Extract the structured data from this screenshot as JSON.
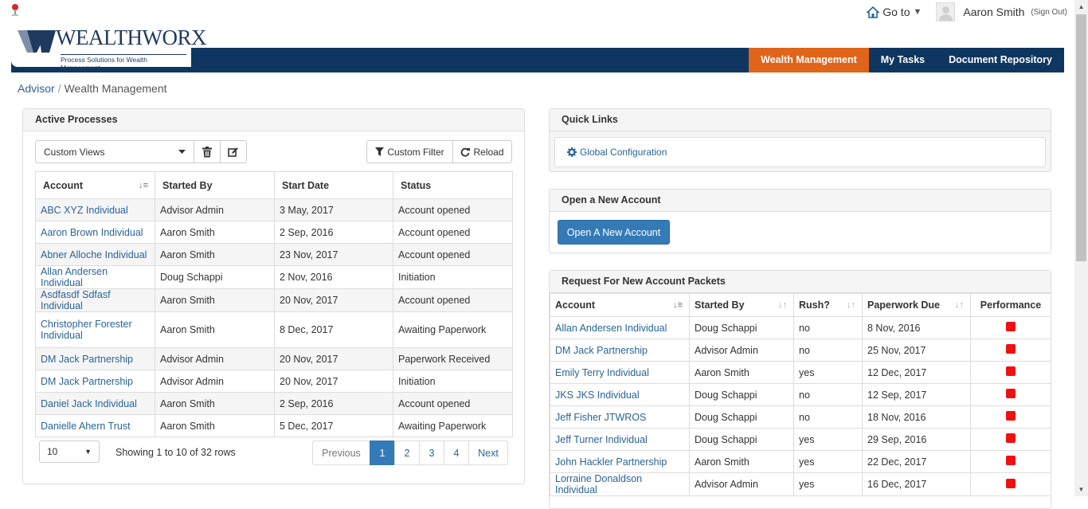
{
  "header": {
    "brand": "WEALTHWORX",
    "tagline": "Process Solutions for Wealth Management",
    "goto_label": "Go to",
    "user_name": "Aaron Smith",
    "signout_label": "(Sign Out)"
  },
  "nav": {
    "items": [
      {
        "label": "Wealth Management",
        "active": true
      },
      {
        "label": "My Tasks",
        "active": false
      },
      {
        "label": "Document Repository",
        "active": false
      }
    ]
  },
  "breadcrumb": {
    "parent": "Advisor",
    "current": "Wealth Management"
  },
  "active_processes": {
    "title": "Active Processes",
    "views_select": "Custom Views",
    "custom_filter_label": "Custom Filter",
    "reload_label": "Reload",
    "columns": [
      "Account",
      "Started By",
      "Start Date",
      "Status"
    ],
    "rows": [
      [
        "ABC XYZ Individual",
        "Advisor Admin",
        "3 May, 2017",
        "Account opened"
      ],
      [
        "Aaron Brown Individual",
        "Aaron Smith",
        "2 Sep, 2016",
        "Account opened"
      ],
      [
        "Abner Alloche Individual",
        "Aaron Smith",
        "23 Nov, 2017",
        "Account opened"
      ],
      [
        "Allan Andersen Individual",
        "Doug Schappi",
        "2 Nov, 2016",
        "Initiation"
      ],
      [
        "Asdfasdf Sdfasf Individual",
        "Aaron Smith",
        "20 Nov, 2017",
        "Account opened"
      ],
      [
        "Christopher Forester Individual",
        "Aaron Smith",
        "8 Dec, 2017",
        "Awaiting Paperwork"
      ],
      [
        "DM Jack Partnership",
        "Advisor Admin",
        "20 Nov, 2017",
        "Paperwork Received"
      ],
      [
        "DM Jack Partnership",
        "Advisor Admin",
        "20 Nov, 2017",
        "Initiation"
      ],
      [
        "Daniel Jack Individual",
        "Aaron Smith",
        "2 Sep, 2016",
        "Account opened"
      ],
      [
        "Danielle Ahern Trust",
        "Aaron Smith",
        "5 Dec, 2017",
        "Awaiting Paperwork"
      ]
    ],
    "page_size": "10",
    "showing_text": "Showing 1 to 10 of 32 rows",
    "pagination": [
      "Previous",
      "1",
      "2",
      "3",
      "4",
      "Next"
    ],
    "active_page": "1"
  },
  "quick_links": {
    "title": "Quick Links",
    "items": [
      "Global Configuration"
    ]
  },
  "open_account": {
    "title": "Open a New Account",
    "button_label": "Open A New Account"
  },
  "packets": {
    "title": "Request For New Account Packets",
    "columns": [
      "Account",
      "Started By",
      "Rush?",
      "Paperwork Due",
      "Performance"
    ],
    "rows": [
      [
        "Allan Andersen Individual",
        "Doug Schappi",
        "no",
        "8 Nov, 2016"
      ],
      [
        "DM Jack Partnership",
        "Advisor Admin",
        "no",
        "25 Nov, 2017"
      ],
      [
        "Emily Terry Individual",
        "Aaron Smith",
        "yes",
        "12 Dec, 2017"
      ],
      [
        "JKS JKS Individual",
        "Doug Schappi",
        "no",
        "12 Sep, 2017"
      ],
      [
        "Jeff Fisher JTWROS",
        "Doug Schappi",
        "no",
        "18 Nov, 2016"
      ],
      [
        "Jeff Turner Individual",
        "Doug Schappi",
        "yes",
        "29 Sep, 2016"
      ],
      [
        "John Hackler Partnership",
        "Aaron Smith",
        "yes",
        "22 Dec, 2017"
      ],
      [
        "Lorraine Donaldson Individual",
        "Advisor Admin",
        "yes",
        "16 Dec, 2017"
      ]
    ],
    "performance_color": "#ee1111"
  },
  "colors": {
    "nav_bg": "#0e3660",
    "nav_active": "#e0641a",
    "link": "#2a6496",
    "primary_button": "#337ab7"
  }
}
